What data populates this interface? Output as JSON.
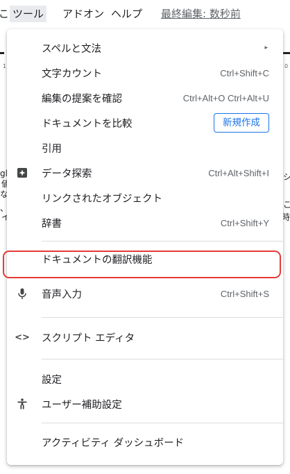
{
  "menubar": {
    "partial_left": "こ",
    "tools": "ツール",
    "addons": "アドオン",
    "help": "ヘルプ",
    "last_edit": "最終編集: 数秒前"
  },
  "background": {
    "left_ruler": "1",
    "right_ruler": "0",
    "left_snippets": [
      "gl",
      "値",
      "な",
      "、",
      "イ"
    ],
    "right_snippets": [
      "シ",
      "こ",
      "時"
    ]
  },
  "menu": {
    "spelling": {
      "label": "スペルと文法",
      "arrow": "▸"
    },
    "word_count": {
      "label": "文字カウント",
      "shortcut": "Ctrl+Shift+C"
    },
    "review_suggestions": {
      "label": "編集の提案を確認",
      "shortcut": "Ctrl+Alt+O Ctrl+Alt+U"
    },
    "compare": {
      "label": "ドキュメントを比較",
      "badge": "新規作成"
    },
    "citations": {
      "label": "引用"
    },
    "explore": {
      "label": "データ探索",
      "shortcut": "Ctrl+Alt+Shift+I",
      "icon": "explore-icon"
    },
    "linked_objects": {
      "label": "リンクされたオブジェクト"
    },
    "dictionary": {
      "label": "辞書",
      "shortcut": "Ctrl+Shift+Y"
    },
    "translate": {
      "label": "ドキュメントの翻訳機能"
    },
    "voice_typing": {
      "label": "音声入力",
      "shortcut": "Ctrl+Shift+S",
      "icon": "microphone-icon"
    },
    "script_editor": {
      "label": "スクリプト エディタ",
      "icon": "code-icon"
    },
    "preferences": {
      "label": "設定"
    },
    "accessibility": {
      "label": "ユーザー補助設定",
      "icon": "accessibility-icon"
    },
    "activity_dashboard": {
      "label": "アクティビティ ダッシュボード"
    }
  },
  "colors": {
    "highlight_border": "#e53935",
    "accent": "#1a73e8",
    "divider": "#dadce0"
  }
}
